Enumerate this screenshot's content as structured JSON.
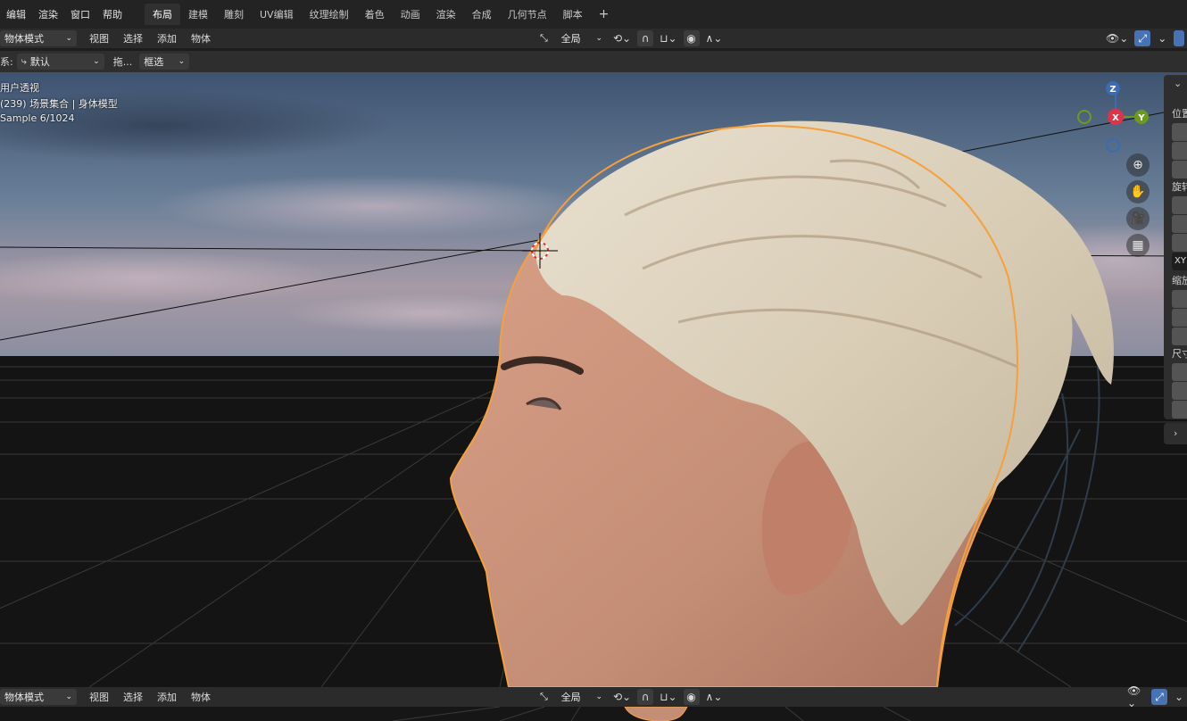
{
  "menubar": {
    "menus": [
      "编辑",
      "渲染",
      "窗口",
      "帮助"
    ],
    "workspaces": [
      "布局",
      "建模",
      "雕刻",
      "UV编辑",
      "纹理绘制",
      "着色",
      "动画",
      "渲染",
      "合成",
      "几何节点",
      "脚本"
    ],
    "active_workspace": "布局",
    "add_workspace": "+"
  },
  "header": {
    "mode": "物体模式",
    "menus": [
      "视图",
      "选择",
      "添加",
      "物体"
    ],
    "transform_orientation": "全局"
  },
  "toolsettings": {
    "orient_label": "系:",
    "orient_value": "默认",
    "drag_label": "拖...",
    "select_mode": "框选"
  },
  "viewport": {
    "view_name": "用户透视",
    "collection_info": "(239) 场景集合 | 身体模型",
    "sample_info": "Sample 6/1024"
  },
  "gizmo": {
    "z": "Z",
    "x": "X",
    "y": "Y"
  },
  "npanel": {
    "location_label": "位置",
    "rotation_label": "旋转",
    "rotation_mode": "XY",
    "scale_label": "缩放",
    "dimensions_label": "尺寸"
  },
  "bottom_header": {
    "mode": "物体模式",
    "menus": [
      "视图",
      "选择",
      "添加",
      "物体"
    ],
    "transform_orientation": "全局"
  },
  "colors": {
    "accent": "#4772b3",
    "selection_outline": "#f6a03c",
    "header_bg": "#2b2b2b"
  }
}
